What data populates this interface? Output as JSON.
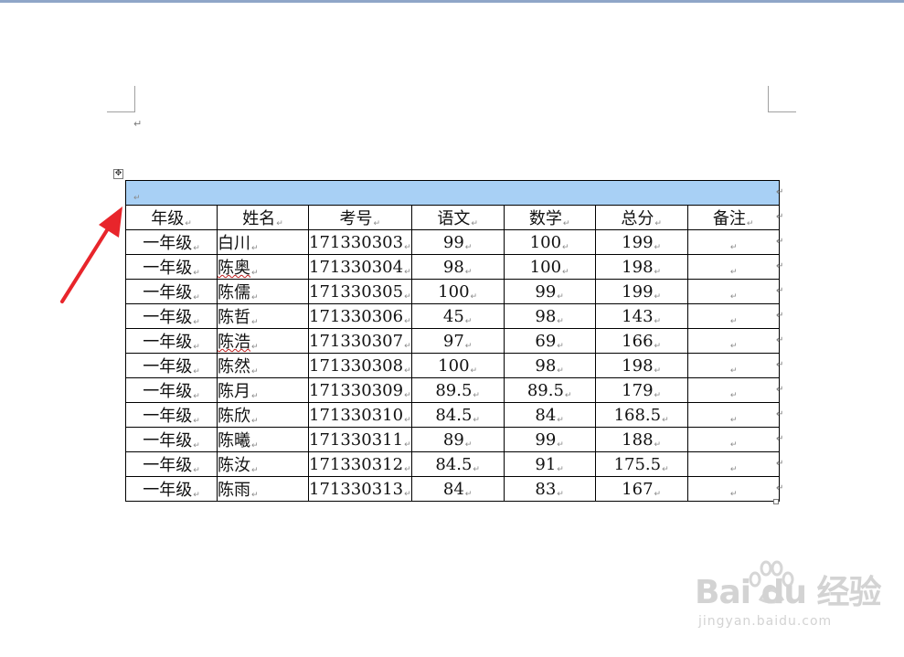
{
  "document": {
    "paragraph_mark": "↵"
  },
  "table": {
    "headers": [
      "年级",
      "姓名",
      "考号",
      "语文",
      "数学",
      "总分",
      "备注"
    ],
    "rows": [
      [
        "一年级",
        "白川",
        "171330303",
        "99",
        "100",
        "199",
        ""
      ],
      [
        "一年级",
        "陈奥",
        "171330304",
        "98",
        "100",
        "198",
        ""
      ],
      [
        "一年级",
        "陈儒",
        "171330305",
        "100",
        "99",
        "199",
        ""
      ],
      [
        "一年级",
        "陈哲",
        "171330306",
        "45",
        "98",
        "143",
        ""
      ],
      [
        "一年级",
        "陈浩",
        "171330307",
        "97",
        "69",
        "166",
        ""
      ],
      [
        "一年级",
        "陈然",
        "171330308",
        "100",
        "98",
        "198",
        ""
      ],
      [
        "一年级",
        "陈月",
        "171330309",
        "89.5",
        "89.5",
        "179",
        ""
      ],
      [
        "一年级",
        "陈欣",
        "171330310",
        "84.5",
        "84",
        "168.5",
        ""
      ],
      [
        "一年级",
        "陈曦",
        "171330311",
        "89",
        "99",
        "188",
        ""
      ],
      [
        "一年级",
        "陈汝",
        "171330312",
        "84.5",
        "91",
        "175.5",
        ""
      ],
      [
        "一年级",
        "陈雨",
        "171330313",
        "84",
        "83",
        "167",
        ""
      ]
    ],
    "selection_color": "#a8d0f5"
  },
  "icons": {
    "move_handle": "move-cross-icon",
    "resize_handle": "resize-square-icon",
    "annotation": "red-arrow-icon"
  },
  "annotation_color": "#e8252b",
  "watermark": {
    "brand": "Bai du 经验",
    "url": "jingyan.baidu.com"
  }
}
